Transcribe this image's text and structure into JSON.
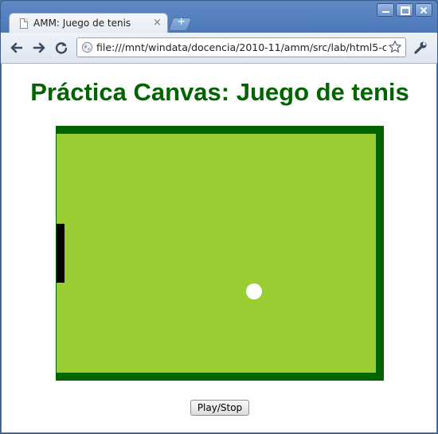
{
  "window": {
    "tab_title": "AMM: Juego de tenis",
    "tab_close": "×",
    "new_tab": "+"
  },
  "toolbar": {
    "url": "file:///mnt/windata/docencia/2010-11/amm/src/lab/html5-c"
  },
  "page": {
    "title": "Práctica Canvas: Juego de tenis",
    "play_button": "Play/Stop"
  },
  "game": {
    "colors": {
      "border": "#006400",
      "court": "#9acd32",
      "paddle": "#000000",
      "ball": "#ffffff"
    },
    "paddle_side": "left",
    "ball_shape": "circle"
  }
}
